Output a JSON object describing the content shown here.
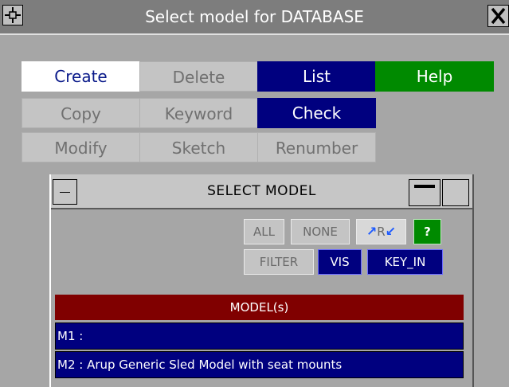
{
  "window": {
    "title": "Select model for DATABASE",
    "plus_icon": "+",
    "close_icon": "X"
  },
  "buttons": {
    "create": "Create",
    "delete": "Delete",
    "list": "List",
    "help": "Help",
    "copy": "Copy",
    "keyword": "Keyword",
    "check": "Check",
    "modify": "Modify",
    "sketch": "Sketch",
    "renumber": "Renumber"
  },
  "select_panel": {
    "title": "SELECT MODEL",
    "all": "ALL",
    "none": "NONE",
    "reverse_label": "R",
    "question": "?",
    "filter": "FILTER",
    "vis": "VIS",
    "key_in": "KEY_IN",
    "list_header": "MODEL(s)",
    "models": [
      {
        "label": "M1 :"
      },
      {
        "label": "M2 : Arup Generic Sled Model with seat mounts"
      }
    ]
  },
  "colors": {
    "window_bg": "#a6a6a6",
    "title_bg": "#7d7d7d",
    "primary_blue": "#00007f",
    "help_green": "#008a00",
    "header_maroon": "#800000"
  }
}
